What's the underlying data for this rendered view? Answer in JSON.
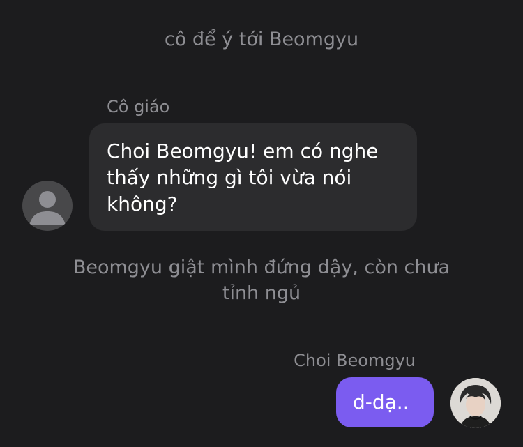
{
  "narration": {
    "line1": "cô để ý tới Beomgyu",
    "line2": "Beomgyu giật mình đứng dậy, còn chưa tỉnh ngủ"
  },
  "messages": [
    {
      "sender": "Cô giáo",
      "text": "Choi Beomgyu! em có nghe thấy những gì tôi vừa nói không?",
      "avatar_icon": "default-user-icon"
    },
    {
      "sender": "Choi Beomgyu",
      "text": "d-dạ..",
      "avatar_icon": "profile-photo",
      "bubble_color": "#7b5cf0"
    }
  ],
  "colors": {
    "background": "#1c1c1e",
    "incoming_bubble": "#2c2c2e",
    "outgoing_bubble": "#7b5cf0",
    "muted_text": "#8e8e93"
  }
}
